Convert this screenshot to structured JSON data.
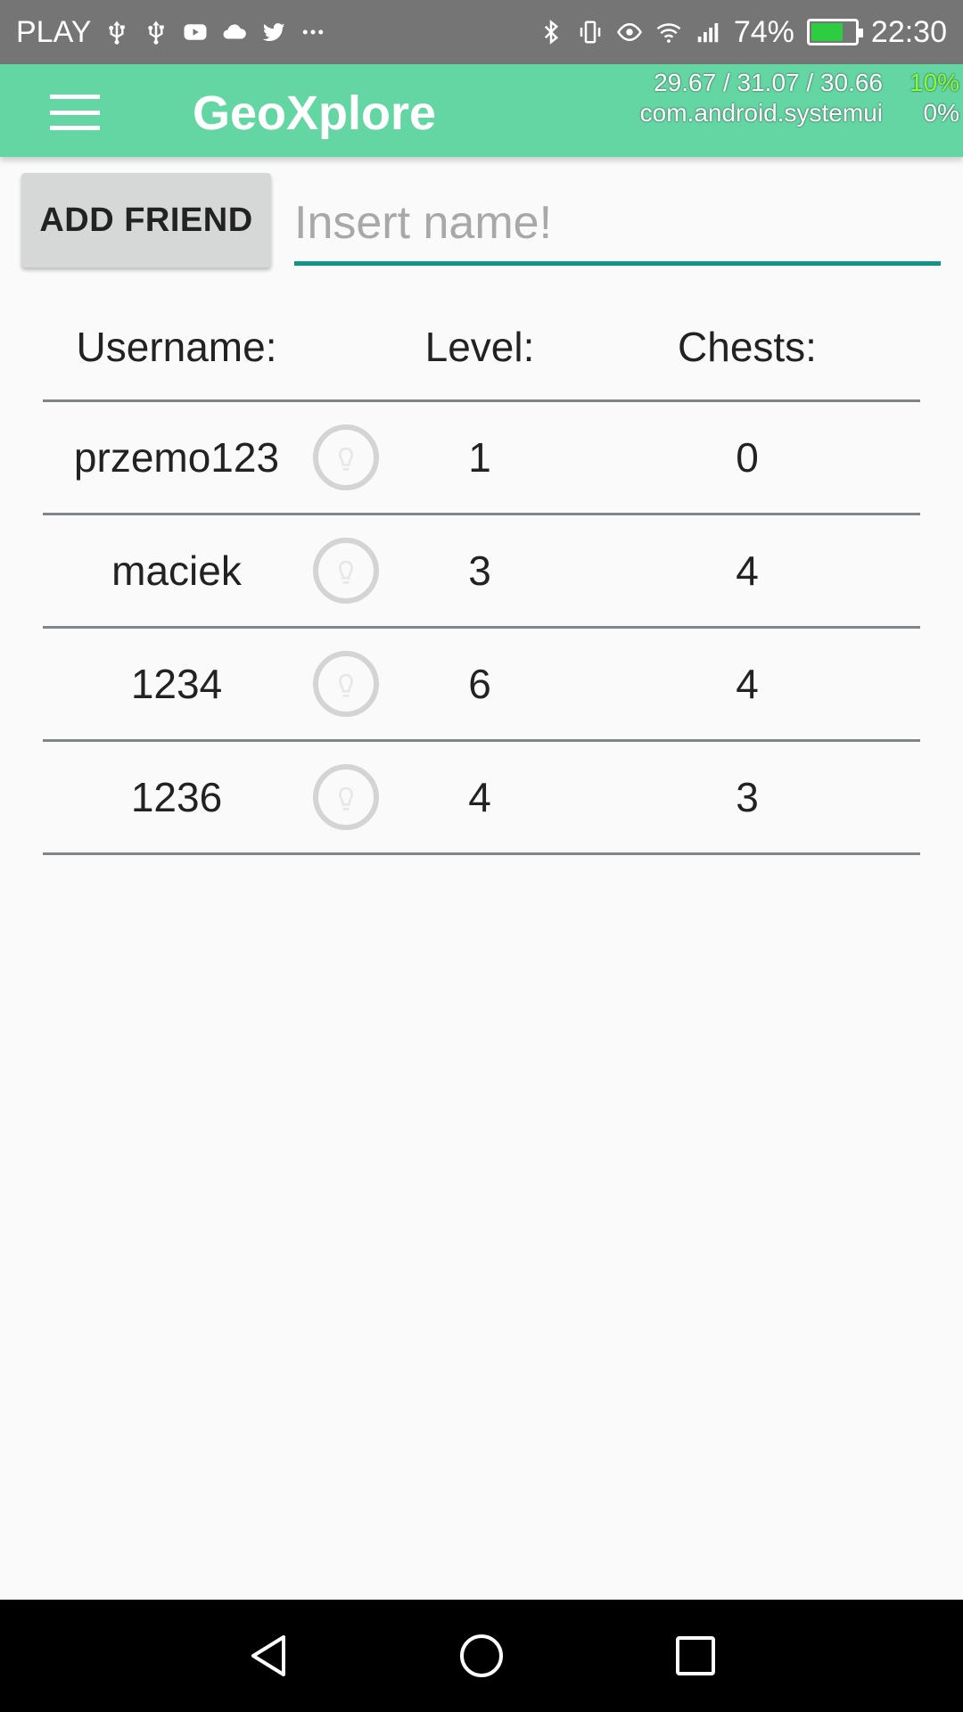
{
  "status_bar": {
    "carrier": "PLAY",
    "battery_percent": "74%",
    "battery_level": 0.74,
    "time": "22:30",
    "left_icons": [
      "usb-icon",
      "usb-icon",
      "youtube-icon",
      "cloud-icon",
      "twitter-icon",
      "more-icon"
    ],
    "right_icons": [
      "bluetooth-icon",
      "vibrate-icon",
      "eye-icon",
      "wifi-icon",
      "signal-icon",
      "battery-icon"
    ]
  },
  "app_bar": {
    "title": "GeoXplore",
    "overlay": {
      "load": "29.67 / 31.07 / 30.66",
      "cpu": "10%",
      "process": "com.android.systemui",
      "process_pct": "0%"
    }
  },
  "add_friend": {
    "button_label": "ADD FRIEND",
    "input_value": "",
    "input_placeholder": "Insert name!"
  },
  "friends_table": {
    "headers": {
      "username": "Username:",
      "level": "Level:",
      "chests": "Chests:"
    },
    "rows": [
      {
        "username": "przemo123",
        "level": "1",
        "chests": "0"
      },
      {
        "username": "maciek",
        "level": "3",
        "chests": "4"
      },
      {
        "username": "1234",
        "level": "6",
        "chests": "4"
      },
      {
        "username": "1236",
        "level": "4",
        "chests": "3"
      }
    ]
  },
  "colors": {
    "app_bar": "#63d6a3",
    "status_bar": "#757575",
    "input_underline": "#13948a",
    "button_bg": "#d6d7d7"
  }
}
